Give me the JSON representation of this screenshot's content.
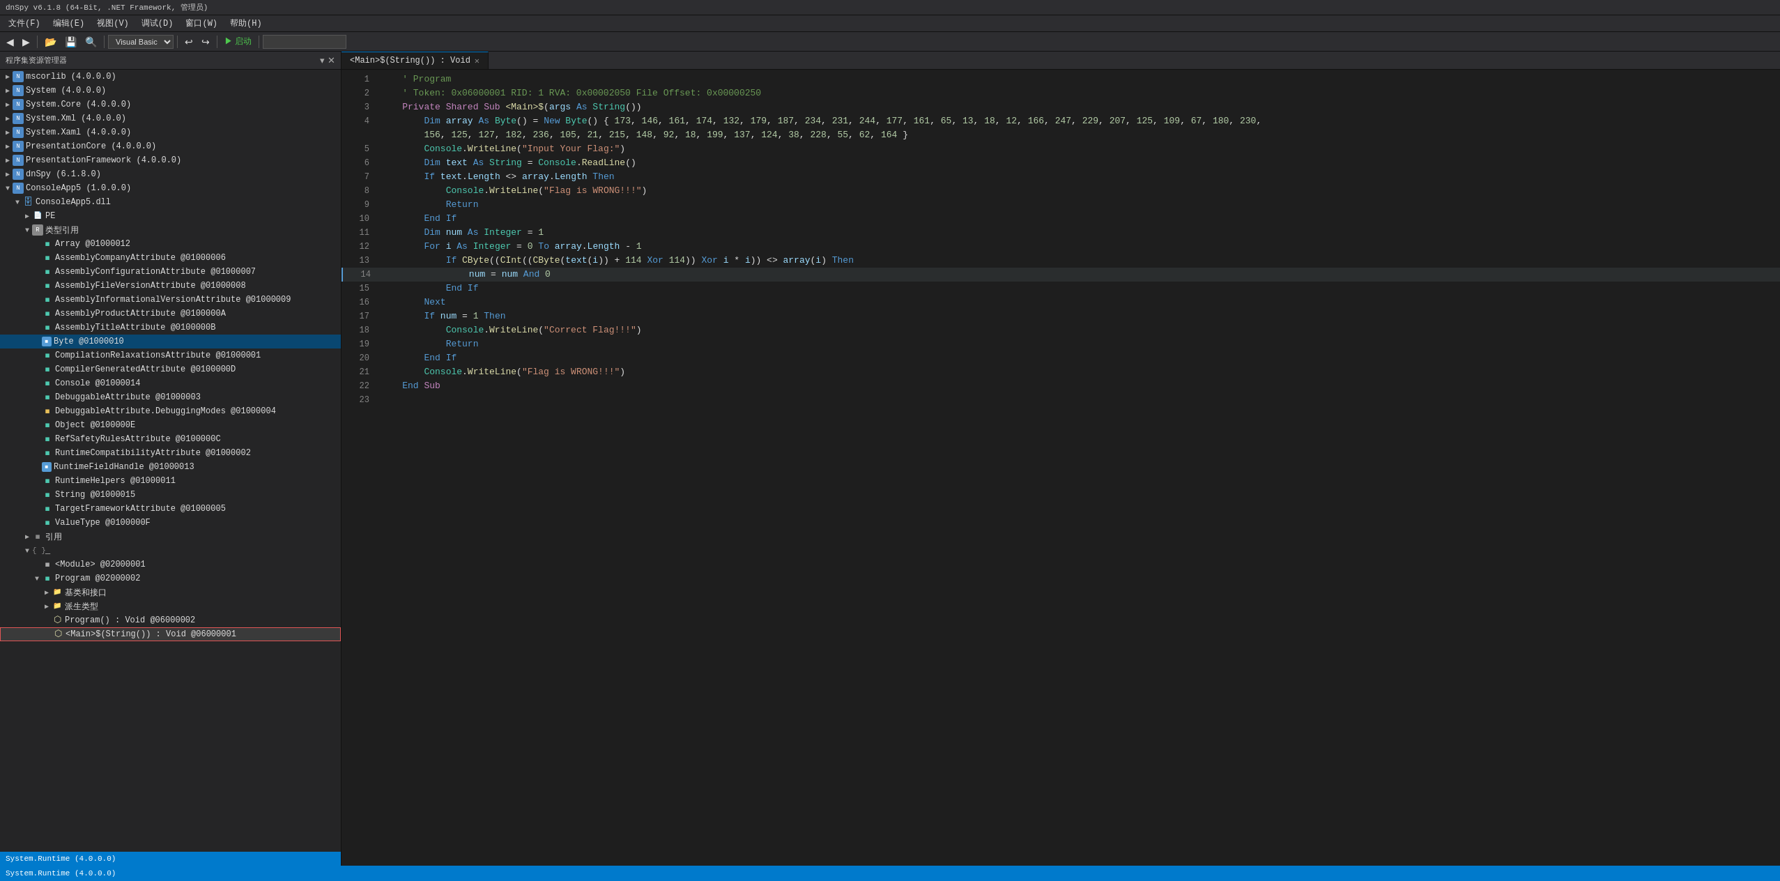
{
  "titleBar": {
    "text": "dnSpy v6.1.8 (64-Bit, .NET Framework, 管理员)"
  },
  "menuBar": {
    "items": [
      "文件(F)",
      "编辑(E)",
      "视图(V)",
      "调试(D)",
      "窗口(W)",
      "帮助(H)"
    ]
  },
  "toolbar": {
    "dropdown": "Visual Basic",
    "buttons": [
      "◀◀",
      "▶",
      "▶▶",
      "⏹",
      "↩",
      "↪",
      "📂",
      "💾",
      "🔍"
    ],
    "nav_back": "◀",
    "nav_forward": "▶",
    "open": "📂",
    "save": "💾",
    "search": "🔍",
    "start": "启动",
    "run_icon": "▶"
  },
  "sidebar": {
    "title": "程序集资源管理器",
    "items": [
      {
        "indent": 0,
        "expand": "▶",
        "icon": "ns",
        "label": "mscorlib (4.0.0.0)"
      },
      {
        "indent": 0,
        "expand": "▶",
        "icon": "ns",
        "label": "System (4.0.0.0)"
      },
      {
        "indent": 0,
        "expand": "▶",
        "icon": "ns",
        "label": "System.Core (4.0.0.0)"
      },
      {
        "indent": 0,
        "expand": "▶",
        "icon": "ns",
        "label": "System.Xml (4.0.0.0)"
      },
      {
        "indent": 0,
        "expand": "▶",
        "icon": "ns",
        "label": "System.Xaml (4.0.0.0)"
      },
      {
        "indent": 0,
        "expand": "▶",
        "icon": "ns",
        "label": "PresentationCore (4.0.0.0)"
      },
      {
        "indent": 0,
        "expand": "▶",
        "icon": "ns",
        "label": "PresentationFramework (4.0.0.0)"
      },
      {
        "indent": 0,
        "expand": "▶",
        "icon": "ns",
        "label": "dnSpy (6.1.8.0)"
      },
      {
        "indent": 0,
        "expand": "▼",
        "icon": "ns",
        "label": "ConsoleApp5 (1.0.0.0)"
      },
      {
        "indent": 1,
        "expand": "▼",
        "icon": "class",
        "label": "ConsoleApp5.dll"
      },
      {
        "indent": 2,
        "expand": "▶",
        "icon": "pe",
        "label": "PE"
      },
      {
        "indent": 2,
        "expand": "▼",
        "icon": "ref",
        "label": "类型引用"
      },
      {
        "indent": 3,
        "expand": "",
        "icon": "arr",
        "label": "Array @01000012"
      },
      {
        "indent": 3,
        "expand": "",
        "icon": "attr",
        "label": "AssemblyCompanyAttribute @01000006"
      },
      {
        "indent": 3,
        "expand": "",
        "icon": "attr",
        "label": "AssemblyConfigurationAttribute @01000007"
      },
      {
        "indent": 3,
        "expand": "",
        "icon": "attr",
        "label": "AssemblyFileVersionAttribute @01000008"
      },
      {
        "indent": 3,
        "expand": "",
        "icon": "attr",
        "label": "AssemblyInformationalVersionAttribute @01000009"
      },
      {
        "indent": 3,
        "expand": "",
        "icon": "attr",
        "label": "AssemblyProductAttribute @0100000A"
      },
      {
        "indent": 3,
        "expand": "",
        "icon": "attr",
        "label": "AssemblyTitleAttribute @0100000B"
      },
      {
        "indent": 3,
        "expand": "",
        "icon": "field",
        "label": "Byte @01000010",
        "selected": true
      },
      {
        "indent": 3,
        "expand": "",
        "icon": "attr",
        "label": "CompilationRelaxationsAttribute @01000001"
      },
      {
        "indent": 3,
        "expand": "",
        "icon": "attr",
        "label": "CompilerGeneratedAttribute @0100000D"
      },
      {
        "indent": 3,
        "expand": "",
        "icon": "class2",
        "label": "Console @01000014"
      },
      {
        "indent": 3,
        "expand": "",
        "icon": "attr",
        "label": "DebuggableAttribute @01000003"
      },
      {
        "indent": 3,
        "expand": "",
        "icon": "attr",
        "label": "DebuggableAttribute.DebuggingModes @01000004"
      },
      {
        "indent": 3,
        "expand": "",
        "icon": "class2",
        "label": "Object @0100000E"
      },
      {
        "indent": 3,
        "expand": "",
        "icon": "attr",
        "label": "RefSafetyRulesAttribute @0100000C"
      },
      {
        "indent": 3,
        "expand": "",
        "icon": "attr",
        "label": "RuntimeCompatibilityAttribute @01000002"
      },
      {
        "indent": 3,
        "expand": "",
        "icon": "field2",
        "label": "RuntimeFieldHandle @01000013"
      },
      {
        "indent": 3,
        "expand": "",
        "icon": "class2",
        "label": "RuntimeHelpers @01000011"
      },
      {
        "indent": 3,
        "expand": "",
        "icon": "class2",
        "label": "String @01000015"
      },
      {
        "indent": 3,
        "expand": "",
        "icon": "attr",
        "label": "TargetFrameworkAttribute @01000005"
      },
      {
        "indent": 3,
        "expand": "",
        "icon": "class2",
        "label": "ValueType @0100000F"
      },
      {
        "indent": 2,
        "expand": "▶",
        "icon": "ref2",
        "label": "引用"
      },
      {
        "indent": 2,
        "expand": "▼",
        "icon": "ns2",
        "label": "{ }  _"
      },
      {
        "indent": 3,
        "expand": "",
        "icon": "mod",
        "label": "<Module> @02000001"
      },
      {
        "indent": 3,
        "expand": "▼",
        "icon": "prog",
        "label": "Program @02000002"
      },
      {
        "indent": 4,
        "expand": "▶",
        "icon": "folder",
        "label": "基类和接口"
      },
      {
        "indent": 4,
        "expand": "▶",
        "icon": "folder2",
        "label": "派生类型"
      },
      {
        "indent": 4,
        "expand": "",
        "icon": "method",
        "label": "Program() : Void @06000002"
      },
      {
        "indent": 4,
        "expand": "",
        "icon": "main",
        "label": "<Main>$(String()) : Void @06000001",
        "highlighted": true
      }
    ],
    "bottomItem": "System.Runtime (4.0.0.0)"
  },
  "tabs": [
    {
      "label": "<Main>$(String()) : Void",
      "active": true,
      "closable": true
    }
  ],
  "code": {
    "lines": [
      {
        "num": 1,
        "content": "    ' Program"
      },
      {
        "num": 2,
        "content": "    ' Token: 0x06000001 RID: 1 RVA: 0x00002050 File Offset: 0x00000250"
      },
      {
        "num": 3,
        "content": "    Private Shared Sub <Main>$(args As String())"
      },
      {
        "num": 4,
        "content": "        Dim array As Byte() = New Byte() { 173, 146, 161, 174, 132, 179, 187, 234, 231, 244, 177, 161, 65, 13, 18, 12, 166, 247, 229, 207, 125, 109, 67, 180, 230,"
      },
      {
        "num": 5,
        "content": "        Console.WriteLine(\"Input Your Flag:\")"
      },
      {
        "num": 6,
        "content": "        Dim text As String = Console.ReadLine()"
      },
      {
        "num": 7,
        "content": "        If text.Length <> array.Length Then"
      },
      {
        "num": 8,
        "content": "            Console.WriteLine(\"Flag is WRONG!!!\")"
      },
      {
        "num": 9,
        "content": "            Return"
      },
      {
        "num": 10,
        "content": "        End If"
      },
      {
        "num": 11,
        "content": "        Dim num As Integer = 1"
      },
      {
        "num": 12,
        "content": "        For i As Integer = 0 To array.Length - 1"
      },
      {
        "num": 13,
        "content": "            If CByte((CInt((CByte(text(i)) + 114 Xor 114)) Xor i * i)) <> array(i) Then"
      },
      {
        "num": 14,
        "content": "                num = num And 0",
        "highlighted": true
      },
      {
        "num": 15,
        "content": "            End If"
      },
      {
        "num": 16,
        "content": "        Next"
      },
      {
        "num": 17,
        "content": "        If num = 1 Then"
      },
      {
        "num": 18,
        "content": "            Console.WriteLine(\"Correct Flag!!!\")"
      },
      {
        "num": 19,
        "content": "            Return"
      },
      {
        "num": 20,
        "content": "        End If"
      },
      {
        "num": 21,
        "content": "        Console.WriteLine(\"Flag is WRONG!!!\")"
      },
      {
        "num": 22,
        "content": "    End Sub"
      },
      {
        "num": 23,
        "content": ""
      }
    ]
  },
  "statusBar": {
    "text": "System.Runtime (4.0.0.0)"
  }
}
